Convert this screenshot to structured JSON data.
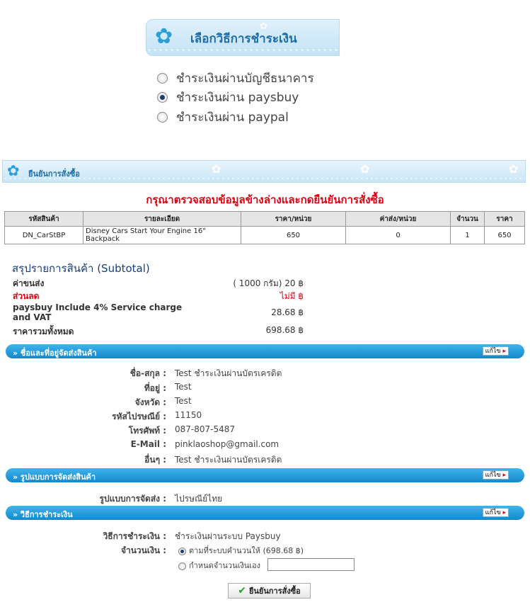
{
  "header": {
    "title": "เลือกวิธีการชำระเงิน"
  },
  "payment_options": [
    {
      "label": "ชำระเงินผ่านบัญชีธนาคาร",
      "selected": false
    },
    {
      "label": "ชำระเงินผ่าน paysbuy",
      "selected": true
    },
    {
      "label": "ชำระเงินผ่าน paypal",
      "selected": false
    }
  ],
  "confirm_section": {
    "title": "ยืนยันการสั่งซื้อ",
    "instruction": "กรุณาตรวจสอบข้อมูลข้างล่างและกดยืนยันการสั่งซื้อ"
  },
  "order_table": {
    "headers": [
      "รหัสสินค้า",
      "รายละเอียด",
      "ราคา/หน่วย",
      "ค่าส่ง/หน่วย",
      "จำนวน",
      "ราคา"
    ],
    "rows": [
      [
        "DN_CarStBP",
        "Disney Cars Start Your Engine 16\" Backpack",
        "650",
        "0",
        "1",
        "650"
      ]
    ]
  },
  "subtotal": {
    "title": "สรุปรายการสินค้า (Subtotal)",
    "shipping_label": "ค่าขนส่ง",
    "shipping_value": "( 1000 กรัม) 20 ฿",
    "discount_label": "ส่วนลด",
    "discount_value": "ไม่มี ฿",
    "service_label": "paysbuy Include 4% Service charge and VAT",
    "service_value": "28.68 ฿",
    "total_label": "ราคารวมทั้งหมด",
    "total_value": "698.68 ฿"
  },
  "address_section": {
    "title": "» ชื่อและที่อยู่จัดส่งสินค้า",
    "edit_label": "แก้ไข",
    "fields": [
      {
        "label": "ชื่อ-สกุล :",
        "value": "Test ชำระเงินผ่านบัตรเครดิต"
      },
      {
        "label": "ที่อยู่ :",
        "value": "Test"
      },
      {
        "label": "จังหวัด :",
        "value": "Test"
      },
      {
        "label": "รหัสไปรษณีย์ :",
        "value": "11150"
      },
      {
        "label": "โทรศัพท์ :",
        "value": "087-807-5487"
      },
      {
        "label": "E-Mail :",
        "value": "pinklaoshop@gmail.com"
      },
      {
        "label": "อื่นๆ :",
        "value": "Test ชำระเงินผ่านบัตรเครดิต"
      }
    ]
  },
  "shipping_section": {
    "title": "» รูปแบบการจัดส่งสินค้า",
    "edit_label": "แก้ไข",
    "label": "รูปแบบการจัดส่ง :",
    "value": "ไปรษณีย์ไทย"
  },
  "payment_section": {
    "title": "» วิธีการชำระเงิน",
    "edit_label": "แก้ไข",
    "method_label": "วิธีการชำระเงิน :",
    "method_value": "ชำระเงินผ่านระบบ Paysbuy",
    "amount_label": "จำนวนเงิน :",
    "amount_option_auto": "ตามที่ระบบคำนวนให้ (698.68 ฿)",
    "amount_option_custom": "กำหนดจำนวนเงินเอง",
    "custom_amount_value": ""
  },
  "confirm_button": {
    "label": "ยืนยันการสั่งซื้อ"
  },
  "colors": {
    "accent_blue": "#1489cb",
    "warning_red": "#e0000f",
    "title_blue": "#1a3f78"
  }
}
